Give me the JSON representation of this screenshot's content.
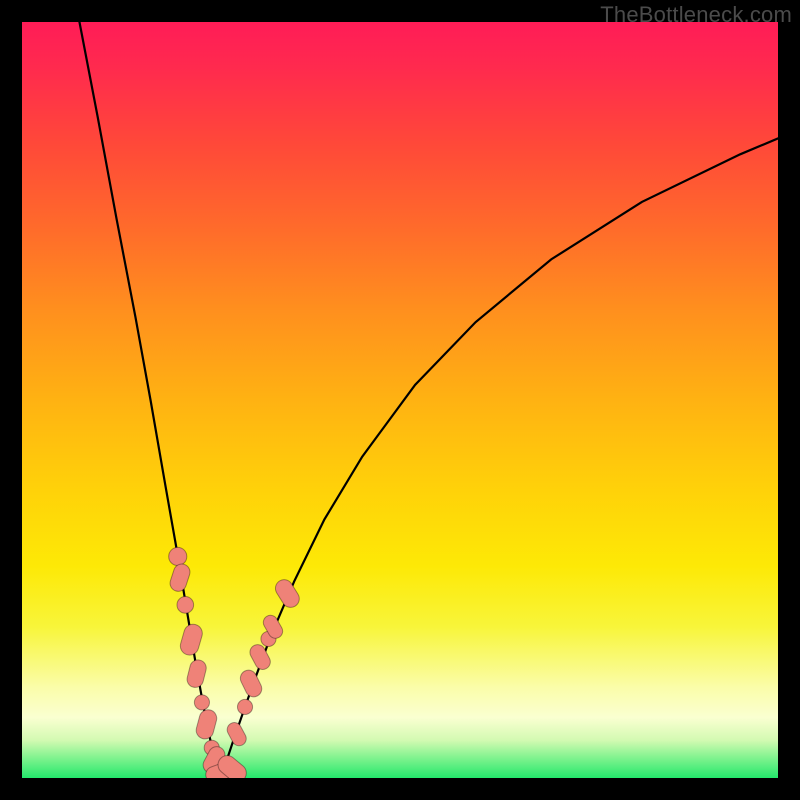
{
  "watermark": "TheBottleneck.com",
  "colors": {
    "frame": "#000000",
    "curve": "#000000",
    "marker": "#ef8278"
  },
  "chart_data": {
    "type": "line",
    "title": "",
    "xlabel": "",
    "ylabel": "",
    "xlim": [
      0,
      100
    ],
    "ylim": [
      0,
      100
    ],
    "grid": false,
    "legend": false,
    "background_gradient": {
      "direction": "vertical",
      "stops": [
        {
          "pos": 0.0,
          "color": "#ff1c57"
        },
        {
          "pos": 0.5,
          "color": "#ffb212"
        },
        {
          "pos": 0.8,
          "color": "#f8f53a"
        },
        {
          "pos": 0.92,
          "color": "#faffd1"
        },
        {
          "pos": 1.0,
          "color": "#24e86c"
        }
      ]
    },
    "series": [
      {
        "name": "left-branch",
        "x": [
          7.6,
          10,
          12.5,
          15,
          17,
          19,
          20.5,
          22,
          23,
          24,
          24.8,
          25.4,
          25.8,
          26.1
        ],
        "values": [
          100,
          87.5,
          74,
          61,
          50,
          38.5,
          30,
          21,
          15,
          9.5,
          5.5,
          3,
          1.3,
          0
        ]
      },
      {
        "name": "right-branch",
        "x": [
          26.1,
          27,
          28,
          29.5,
          31,
          33,
          36,
          40,
          45,
          52,
          60,
          70,
          82,
          95,
          100
        ],
        "values": [
          0,
          2.1,
          5.1,
          9.4,
          13.6,
          19,
          26,
          34.2,
          42.5,
          52,
          60.3,
          68.6,
          76.2,
          82.5,
          84.6
        ]
      }
    ],
    "markers": [
      {
        "x": 20.6,
        "y": 29.3,
        "r": 1.2
      },
      {
        "x": 20.9,
        "y": 26.5,
        "r": 1.6,
        "pill": true,
        "angle": -72
      },
      {
        "x": 21.6,
        "y": 22.9,
        "r": 1.1
      },
      {
        "x": 22.4,
        "y": 18.3,
        "r": 1.8,
        "pill": true,
        "angle": -74
      },
      {
        "x": 23.1,
        "y": 13.8,
        "r": 1.6,
        "pill": true,
        "angle": -76
      },
      {
        "x": 23.8,
        "y": 10.0,
        "r": 1.0
      },
      {
        "x": 24.4,
        "y": 7.1,
        "r": 1.7,
        "pill": true,
        "angle": -75
      },
      {
        "x": 25.1,
        "y": 4.0,
        "r": 1.0
      },
      {
        "x": 25.4,
        "y": 2.4,
        "r": 1.6,
        "pill": true,
        "angle": -62
      },
      {
        "x": 26.1,
        "y": 0.7,
        "r": 1.6,
        "pill": true,
        "angle": -20
      },
      {
        "x": 27.8,
        "y": 1.2,
        "r": 1.8,
        "pill": true,
        "angle": 40
      },
      {
        "x": 28.4,
        "y": 5.8,
        "r": 1.4,
        "pill": true,
        "angle": 62
      },
      {
        "x": 29.5,
        "y": 9.4,
        "r": 1.0
      },
      {
        "x": 30.3,
        "y": 12.5,
        "r": 1.6,
        "pill": true,
        "angle": 64
      },
      {
        "x": 31.5,
        "y": 16.0,
        "r": 1.5,
        "pill": true,
        "angle": 62
      },
      {
        "x": 32.6,
        "y": 18.4,
        "r": 1.0
      },
      {
        "x": 33.2,
        "y": 20.0,
        "r": 1.4,
        "pill": true,
        "angle": 60
      },
      {
        "x": 35.1,
        "y": 24.4,
        "r": 1.7,
        "pill": true,
        "angle": 58
      }
    ],
    "notch_x": 26.1
  }
}
